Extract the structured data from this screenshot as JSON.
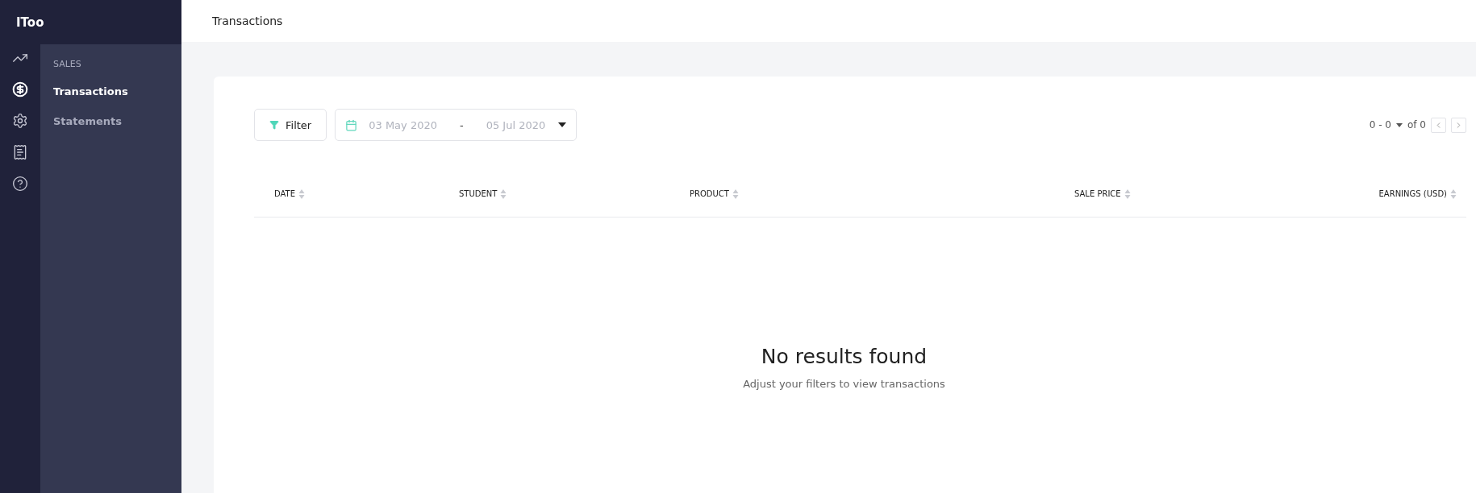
{
  "app": {
    "logo": "IToo"
  },
  "rail": [
    {
      "kind": "chart",
      "selected": false
    },
    {
      "kind": "dollar",
      "selected": true
    },
    {
      "kind": "gear",
      "selected": false
    },
    {
      "kind": "receipt",
      "selected": false
    },
    {
      "kind": "help",
      "selected": false
    }
  ],
  "subnav": {
    "section": "SALES",
    "items": [
      {
        "label": "Transactions",
        "selected": true
      },
      {
        "label": "Statements",
        "selected": false
      }
    ]
  },
  "header": {
    "title": "Transactions"
  },
  "toolbar": {
    "filter_button": "Filter",
    "date_range": {
      "start": "03 May 2020",
      "separator": "-",
      "end": "05 Jul 2020"
    },
    "pagination": {
      "range": "0 - 0",
      "total": "of 0"
    }
  },
  "table": {
    "columns": [
      {
        "label": "DATE"
      },
      {
        "label": "STUDENT"
      },
      {
        "label": "PRODUCT"
      },
      {
        "label": "SALE PRICE"
      },
      {
        "label": "EARNINGS (USD)"
      }
    ]
  },
  "empty_state": {
    "title": "No results found",
    "message": "Adjust your filters to view transactions"
  }
}
